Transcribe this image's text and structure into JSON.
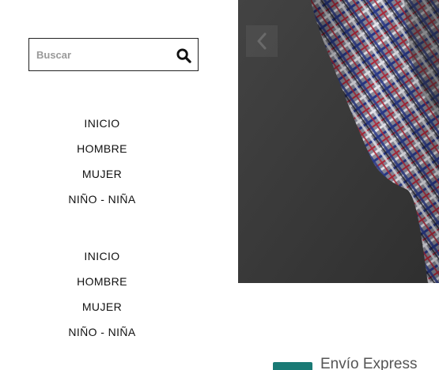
{
  "search": {
    "placeholder": "Buscar",
    "value": "",
    "icon": "search-icon"
  },
  "nav_primary": {
    "items": [
      {
        "label": "INICIO"
      },
      {
        "label": "HOMBRE"
      },
      {
        "label": "MUJER"
      },
      {
        "label": "NIÑO - NIÑA"
      }
    ]
  },
  "nav_secondary": {
    "items": [
      {
        "label": "INICIO"
      },
      {
        "label": "HOMBRE"
      },
      {
        "label": "MUJER"
      },
      {
        "label": "NIÑO - NIÑA"
      }
    ]
  },
  "hero": {
    "prev_icon": "chevron-left-icon"
  },
  "features": {
    "shipping_label": "Envío Express",
    "accent_color": "#1a7a75"
  }
}
